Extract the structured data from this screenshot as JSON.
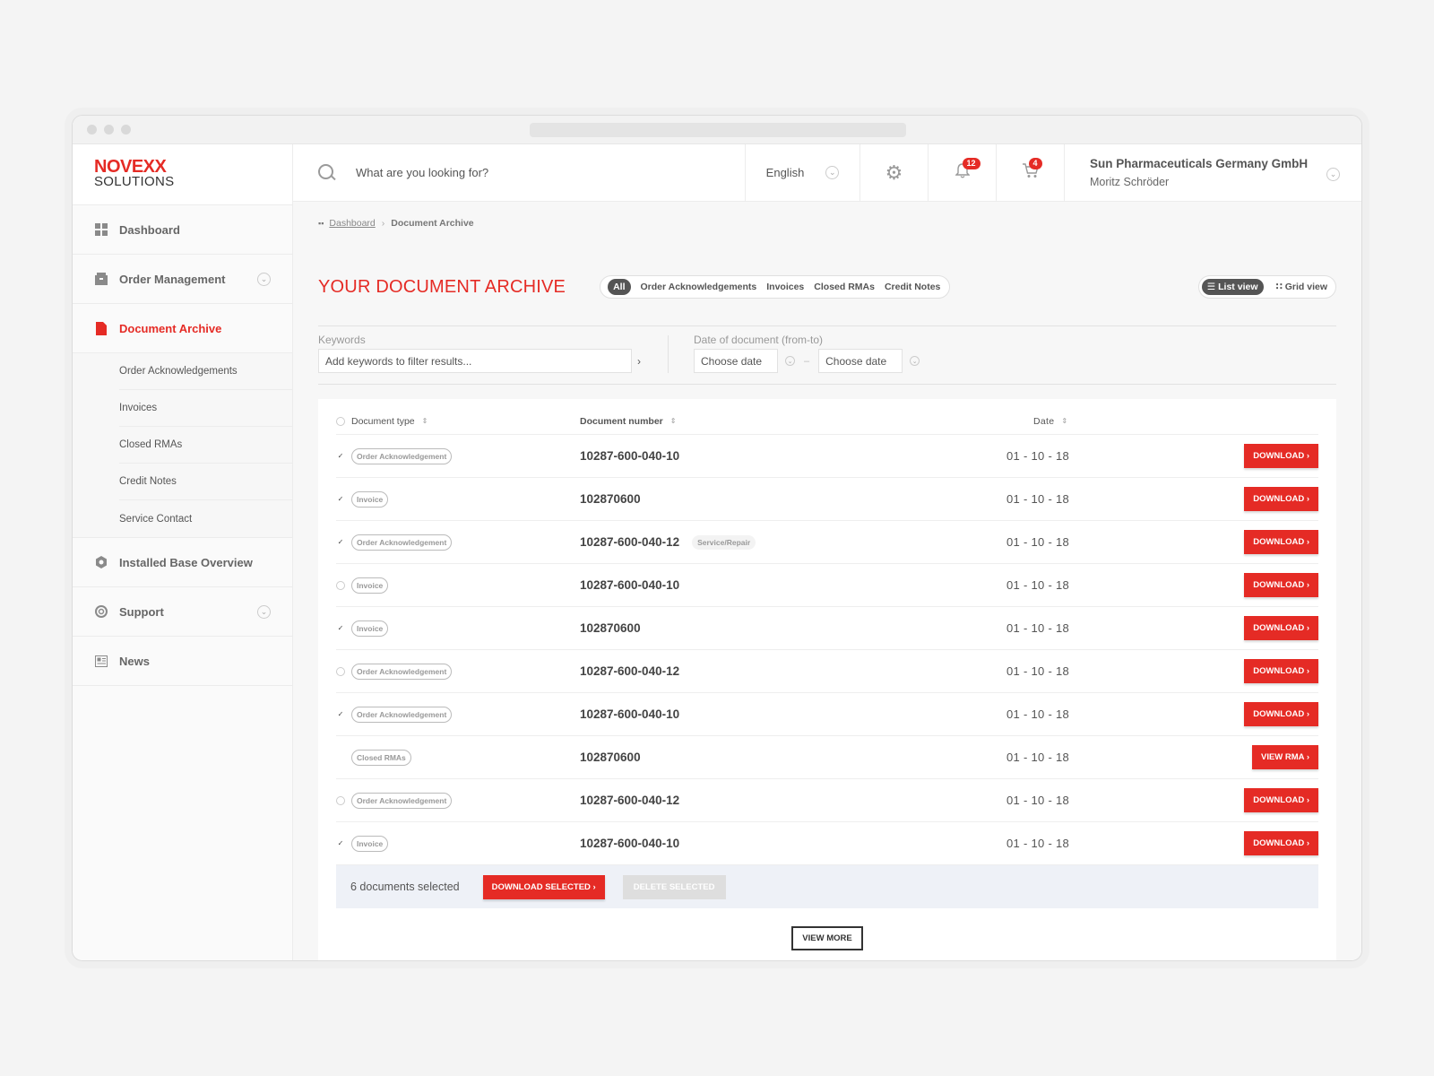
{
  "brand": {
    "logo_top": "NOVEXX",
    "logo_bottom": "SOLUTIONS",
    "accent": "#e52b25"
  },
  "sidebar": {
    "items": [
      {
        "label": "Dashboard",
        "icon": "grid-icon"
      },
      {
        "label": "Order Management",
        "icon": "box-icon",
        "expandable": true
      },
      {
        "label": "Document Archive",
        "icon": "document-icon",
        "active": true
      },
      {
        "label": "Installed Base Overview",
        "icon": "gear-icon"
      },
      {
        "label": "Support",
        "icon": "lifebuoy-icon",
        "expandable": true
      },
      {
        "label": "News",
        "icon": "newspaper-icon"
      }
    ],
    "subitems": [
      "Order Acknowledgements",
      "Invoices",
      "Closed RMAs",
      "Credit Notes",
      "Service Contact"
    ]
  },
  "topbar": {
    "search_placeholder": "What are you looking for?",
    "language": "English",
    "notifications_count": "12",
    "cart_count": "4",
    "company": "Sun Pharmaceuticals Germany GmbH",
    "user": "Moritz Schröder"
  },
  "breadcrumb": {
    "home": "Dashboard",
    "current": "Document Archive"
  },
  "page": {
    "title": "YOUR DOCUMENT ARCHIVE",
    "filters": [
      "All",
      "Order Acknowledgements",
      "Invoices",
      "Closed RMAs",
      "Credit Notes"
    ],
    "active_filter": "All",
    "list_view": "List view",
    "grid_view": "Grid view"
  },
  "search_filters": {
    "keywords_label": "Keywords",
    "keywords_placeholder": "Add keywords to filter results...",
    "date_label": "Date of document (from-to)",
    "date_from": "Choose date",
    "date_to": "Choose date"
  },
  "table": {
    "columns": [
      "Document type",
      "Document number",
      "Date"
    ],
    "rows": [
      {
        "checked": true,
        "type": "Order Acknowledgement",
        "number": "10287-600-040-10",
        "extra": "",
        "date": "01 - 10 - 18",
        "action": "DOWNLOAD ›"
      },
      {
        "checked": true,
        "type": "Invoice",
        "number": "102870600",
        "extra": "",
        "date": "01 - 10 - 18",
        "action": "DOWNLOAD ›"
      },
      {
        "checked": true,
        "type": "Order Acknowledgement",
        "number": "10287-600-040-12",
        "extra": "Service/Repair",
        "date": "01 - 10 - 18",
        "action": "DOWNLOAD ›"
      },
      {
        "checked": false,
        "type": "Invoice",
        "number": "10287-600-040-10",
        "extra": "",
        "date": "01 - 10 - 18",
        "action": "DOWNLOAD ›"
      },
      {
        "checked": true,
        "type": "Invoice",
        "number": "102870600",
        "extra": "",
        "date": "01 - 10 - 18",
        "action": "DOWNLOAD ›"
      },
      {
        "checked": false,
        "type": "Order Acknowledgement",
        "number": "10287-600-040-12",
        "extra": "",
        "date": "01 - 10 - 18",
        "action": "DOWNLOAD ›"
      },
      {
        "checked": true,
        "type": "Order Acknowledgement",
        "number": "10287-600-040-10",
        "extra": "",
        "date": "01 - 10 - 18",
        "action": "DOWNLOAD ›"
      },
      {
        "checked": null,
        "type": "Closed RMAs",
        "number": "102870600",
        "extra": "",
        "date": "01 - 10 - 18",
        "action": "VIEW RMA ›"
      },
      {
        "checked": false,
        "type": "Order Acknowledgement",
        "number": "10287-600-040-12",
        "extra": "",
        "date": "01 - 10 - 18",
        "action": "DOWNLOAD ›"
      },
      {
        "checked": true,
        "type": "Invoice",
        "number": "10287-600-040-10",
        "extra": "",
        "date": "01 - 10 - 18",
        "action": "DOWNLOAD ›"
      }
    ]
  },
  "selection": {
    "text": "6 documents selected",
    "download_selected": "DOWNLOAD SELECTED ›",
    "delete_selected": "DELETE SELECTED"
  },
  "view_more": "VIEW MORE"
}
